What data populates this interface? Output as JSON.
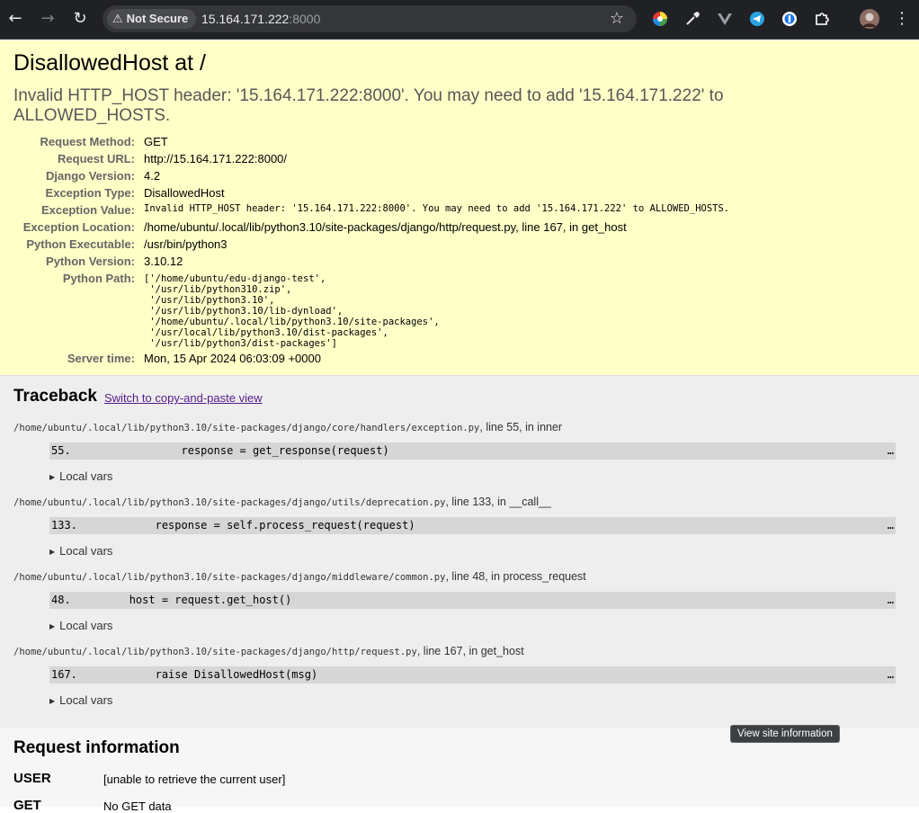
{
  "browser": {
    "security_label": "Not Secure",
    "url_host": "15.164.171.222",
    "url_port": ":8000",
    "extensions": [
      "color-picker-icon",
      "eyedropper-icon",
      "vue-icon",
      "telegram-icon",
      "password-icon",
      "puzzle-extensions-icon"
    ]
  },
  "summary": {
    "title": "DisallowedHost at /",
    "exception_message": "Invalid HTTP_HOST header: '15.164.171.222:8000'. You may need to add '15.164.171.222' to ALLOWED_HOSTS.",
    "rows": [
      {
        "label": "Request Method:",
        "value": "GET"
      },
      {
        "label": "Request URL:",
        "value": "http://15.164.171.222:8000/"
      },
      {
        "label": "Django Version:",
        "value": "4.2"
      },
      {
        "label": "Exception Type:",
        "value": "DisallowedHost"
      },
      {
        "label": "Exception Value:",
        "value": "Invalid HTTP_HOST header: '15.164.171.222:8000'. You may need to add '15.164.171.222' to ALLOWED_HOSTS."
      },
      {
        "label": "Exception Location:",
        "value": "/home/ubuntu/.local/lib/python3.10/site-packages/django/http/request.py, line 167, in get_host"
      },
      {
        "label": "Python Executable:",
        "value": "/usr/bin/python3"
      },
      {
        "label": "Python Version:",
        "value": "3.10.12"
      },
      {
        "label": "Python Path:",
        "value": "['/home/ubuntu/edu-django-test',\n '/usr/lib/python310.zip',\n '/usr/lib/python3.10',\n '/usr/lib/python3.10/lib-dynload',\n '/home/ubuntu/.local/lib/python3.10/site-packages',\n '/usr/local/lib/python3.10/dist-packages',\n '/usr/lib/python3/dist-packages']"
      },
      {
        "label": "Server time:",
        "value": "Mon, 15 Apr 2024 06:03:09 +0000"
      }
    ]
  },
  "traceback": {
    "title": "Traceback",
    "switch_link": "Switch to copy-and-paste view",
    "frames": [
      {
        "path": "/home/ubuntu/.local/lib/python3.10/site-packages/django/core/handlers/exception.py",
        "location": ", line 55, in inner",
        "line": "55.                 response = get_response(request)",
        "local_vars": "Local vars"
      },
      {
        "path": "/home/ubuntu/.local/lib/python3.10/site-packages/django/utils/deprecation.py",
        "location": ", line 133, in __call__",
        "line": "133.            response = self.process_request(request)",
        "local_vars": "Local vars"
      },
      {
        "path": "/home/ubuntu/.local/lib/python3.10/site-packages/django/middleware/common.py",
        "location": ", line 48, in process_request",
        "line": "48.         host = request.get_host()",
        "local_vars": "Local vars"
      },
      {
        "path": "/home/ubuntu/.local/lib/python3.10/site-packages/django/http/request.py",
        "location": ", line 167, in get_host",
        "line": "167.            raise DisallowedHost(msg)",
        "local_vars": "Local vars"
      }
    ],
    "ellipsis": "…"
  },
  "request_info": {
    "title": "Request information",
    "user_key": "USER",
    "user_value": "[unable to retrieve the current user]",
    "get_key": "GET",
    "get_value": "No GET data"
  },
  "tooltip": "View site information"
}
